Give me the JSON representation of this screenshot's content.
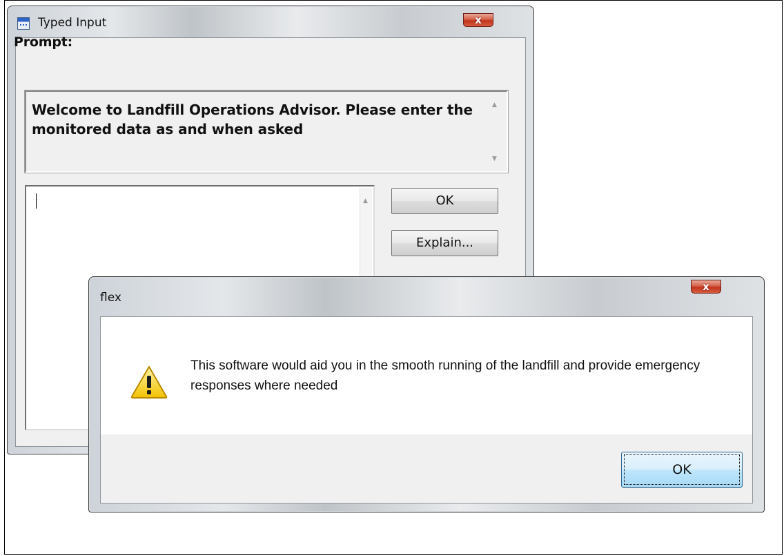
{
  "typed_input": {
    "title": "Typed Input",
    "close_glyph": "x",
    "prompt_label": "Prompt:",
    "prompt_text": "Welcome to Landfill Operations Advisor. Please enter the monitored data as and when asked",
    "input_value": "",
    "ok_label": "OK",
    "explain_label": "Explain..."
  },
  "flex": {
    "title": "flex",
    "close_glyph": "x",
    "message": "This software would aid you in the smooth running of the landfill and provide emergency responses where needed",
    "ok_label": "OK"
  },
  "icons": {
    "app": "app-window-icon",
    "warning": "warning-icon"
  },
  "colors": {
    "close_button": "#c2341c",
    "warning_yellow": "#f7d417",
    "ok_button_focus": "#bee6fd"
  }
}
